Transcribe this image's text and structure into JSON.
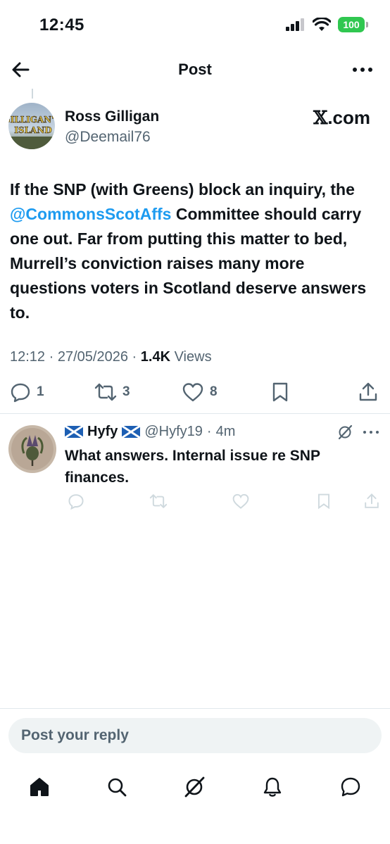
{
  "status_bar": {
    "time": "12:45",
    "battery": "100",
    "battery_color": "#30c750"
  },
  "nav": {
    "title": "Post",
    "back_icon": "arrow-left-icon",
    "more_icon": "more-horizontal-icon"
  },
  "post": {
    "author_name": "Ross Gilligan",
    "author_handle": "@Deemail76",
    "avatar_text_top": "GILLIGAN'S",
    "avatar_text_bottom": "ISLAND",
    "source_label_x": "𝕏",
    "source_label_rest": ".com",
    "body_before": "If the SNP (with Greens) block an inquiry, the ",
    "mention": "@CommonsScotAffs",
    "body_after": " Committee should carry one out.  Far from putting this matter to bed, Murrell’s conviction raises many more questions voters in Scotland deserve answers to.",
    "time": "12:12",
    "date": "27/05/2026",
    "separator": "·",
    "views_count": "1.4K",
    "views_label": "Views",
    "replies": "1",
    "reposts": "3",
    "likes": "8"
  },
  "reply": {
    "name": "Hyfy",
    "handle": "@Hyfy19",
    "separator": "·",
    "time": "4m",
    "text": "What answers. Internal issue re SNP finances."
  },
  "composer": {
    "placeholder": "Post your reply"
  },
  "colors": {
    "accent": "#1d9bf0",
    "secondary_text": "#536471",
    "primary_text": "#0f1419"
  }
}
